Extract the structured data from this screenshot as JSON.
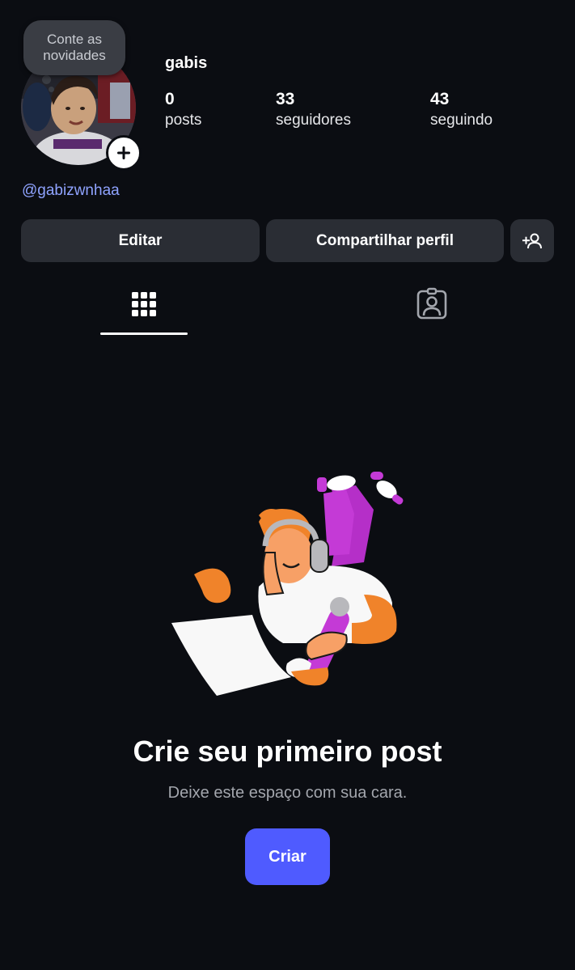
{
  "profile": {
    "bubble_text": "Conte as novidades",
    "name": "gabis",
    "handle": "@gabizwnhaa",
    "stats": [
      {
        "value": "0",
        "label": "posts"
      },
      {
        "value": "33",
        "label": "seguidores"
      },
      {
        "value": "43",
        "label": "seguindo"
      }
    ]
  },
  "actions": {
    "edit_label": "Editar",
    "share_label": "Compartilhar perfil",
    "add_friend_icon": "add-person-icon"
  },
  "tabs": [
    {
      "icon": "grid-icon",
      "active": true
    },
    {
      "icon": "tagged-person-icon",
      "active": false
    }
  ],
  "empty_state": {
    "title": "Crie seu primeiro post",
    "subtitle": "Deixe este espaço com sua cara.",
    "button_label": "Criar"
  },
  "colors": {
    "background": "#0b0d12",
    "button": "#2a2d34",
    "accent": "#4f5bff",
    "handle": "#8fa3ff"
  }
}
